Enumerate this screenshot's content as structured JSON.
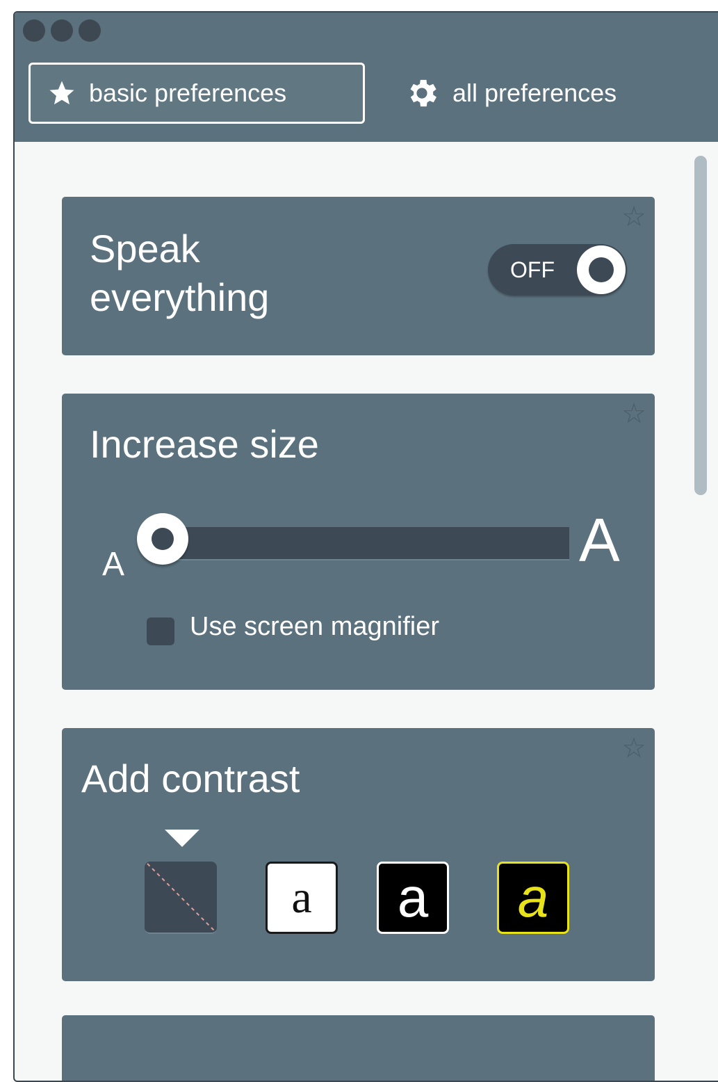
{
  "window": {
    "dots": [
      "close",
      "minimize",
      "maximize"
    ]
  },
  "tabs": {
    "basic": {
      "label": "basic preferences",
      "icon": "star-icon",
      "active": true
    },
    "all": {
      "label": "all preferences",
      "icon": "gear-icon",
      "active": false
    }
  },
  "speak": {
    "title_line1": "Speak",
    "title_line2": "everything",
    "toggle_label": "OFF",
    "toggle_state": false
  },
  "size": {
    "title": "Increase size",
    "small_label": "A",
    "large_label": "A",
    "slider_value": 0,
    "magnifier_label": "Use screen magnifier",
    "magnifier_checked": false
  },
  "contrast": {
    "title": "Add contrast",
    "selected_index": 0,
    "options": [
      {
        "name": "none",
        "glyph": ""
      },
      {
        "name": "black-on-white",
        "glyph": "a"
      },
      {
        "name": "white-on-black",
        "glyph": "a"
      },
      {
        "name": "yellow-on-black",
        "glyph": "a"
      }
    ]
  },
  "colors": {
    "panel": "#5b717d",
    "dark": "#3d4a56",
    "yellow": "#e8e21a"
  }
}
